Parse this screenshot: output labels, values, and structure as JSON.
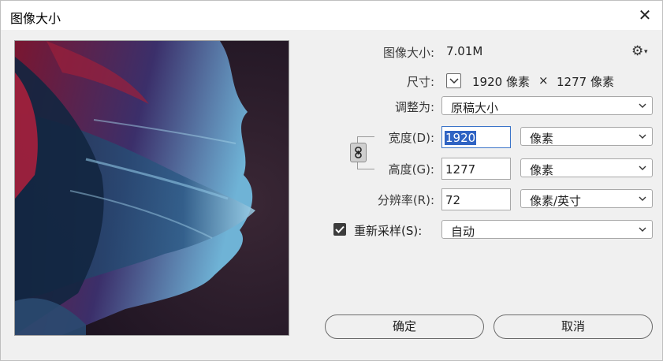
{
  "window": {
    "title": "图像大小"
  },
  "info": {
    "size_label": "图像大小:",
    "size_value": "7.01M",
    "dim_label": "尺寸:",
    "dim_width": "1920 像素",
    "dim_sep": "×",
    "dim_height": "1277 像素"
  },
  "fit": {
    "label": "调整为:",
    "value": "原稿大小"
  },
  "width": {
    "label": "宽度(D):",
    "value": "1920",
    "unit": "像素"
  },
  "height": {
    "label": "高度(G):",
    "value": "1277",
    "unit": "像素"
  },
  "resolution": {
    "label": "分辨率(R):",
    "value": "72",
    "unit": "像素/英寸"
  },
  "resample": {
    "label": "重新采样(S):",
    "checked": true,
    "value": "自动"
  },
  "buttons": {
    "ok": "确定",
    "cancel": "取消"
  },
  "icons": {
    "close": "✕",
    "gear": "⚙",
    "gear_caret": "▾"
  }
}
